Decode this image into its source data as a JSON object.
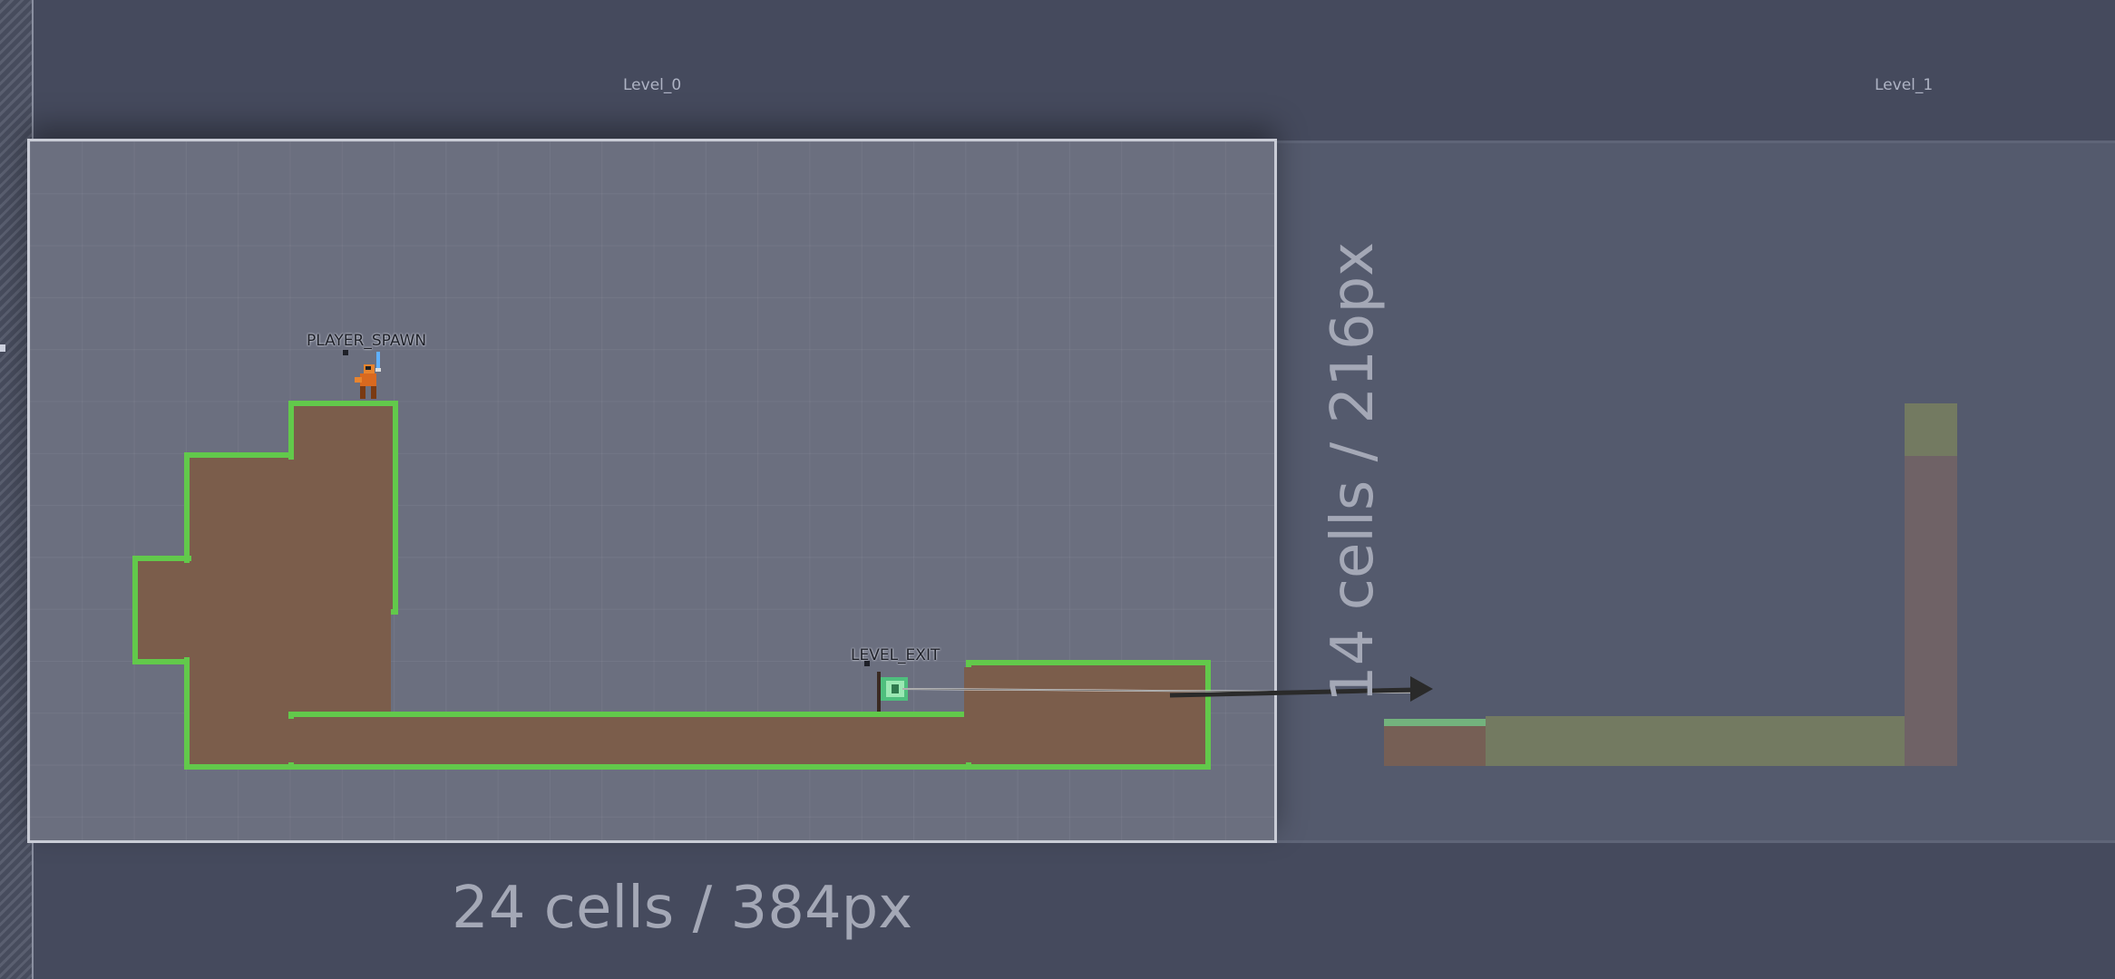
{
  "levels": [
    {
      "name": "Level_0",
      "width_label": "24 cells / 384px",
      "height_label": "14 cells / 216px"
    },
    {
      "name": "Level_1"
    }
  ],
  "entities": [
    {
      "name": "PLAYER_SPAWN"
    },
    {
      "name": "LEVEL_EXIT"
    }
  ],
  "colors": {
    "background": "#454a5d",
    "level_selected": "#6b6f7f",
    "terrain": "#7b5d4b",
    "grass": "#62c94b",
    "link_arrow": "#2a2a2a"
  },
  "icons": [
    "player-sprite-icon",
    "exit-flag-icon",
    "link-arrow-icon"
  ]
}
